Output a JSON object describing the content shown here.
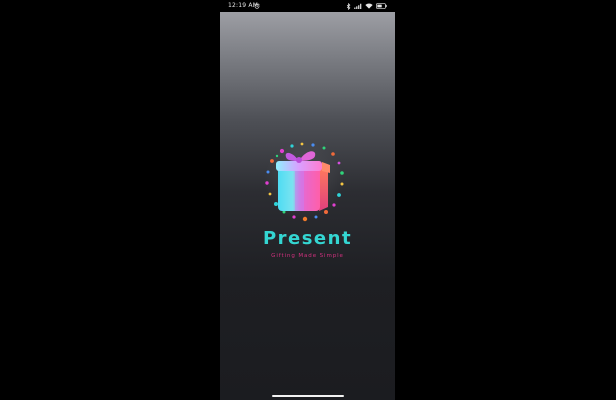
{
  "status_bar": {
    "time": "12:19 AM",
    "icons": [
      "alarm-icon",
      "bluetooth-icon",
      "signal-icon",
      "wifi-icon",
      "battery-icon"
    ]
  },
  "splash": {
    "app_name": "Present",
    "tagline": "Gifting Made Simple",
    "logo_icon": "gift-box-icon"
  },
  "colors": {
    "title": "#34d6d2",
    "tagline": "#d4307f",
    "gift_cyan": "#5fe1f2",
    "gift_pink": "#e05bd8",
    "background_top": "#a6a7ad",
    "background_bottom": "#1b1c20"
  }
}
